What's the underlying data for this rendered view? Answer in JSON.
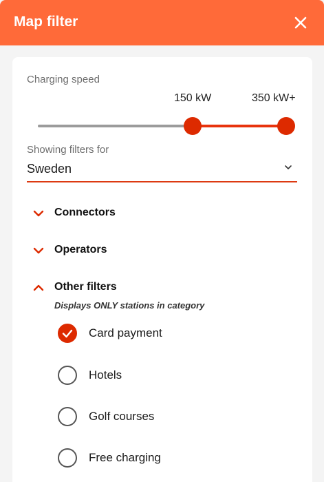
{
  "header": {
    "title": "Map filter",
    "close_icon": "close-icon"
  },
  "colors": {
    "accent": "#ff6a39",
    "primary": "#dd2a00",
    "track_inactive": "#9b9b9b"
  },
  "charging_speed": {
    "label": "Charging speed",
    "min_label": "150 kW",
    "max_label": "350 kW+"
  },
  "country": {
    "label": "Showing filters for",
    "value": "Sweden",
    "icon": "chevron-down-icon"
  },
  "sections": [
    {
      "label": "Connectors",
      "expanded": false
    },
    {
      "label": "Operators",
      "expanded": false
    },
    {
      "label": "Other filters",
      "expanded": true,
      "note": "Displays ONLY stations in category"
    }
  ],
  "other_filters": [
    {
      "label": "Card payment",
      "checked": true
    },
    {
      "label": "Hotels",
      "checked": false
    },
    {
      "label": "Golf courses",
      "checked": false
    },
    {
      "label": "Free charging",
      "checked": false
    }
  ]
}
